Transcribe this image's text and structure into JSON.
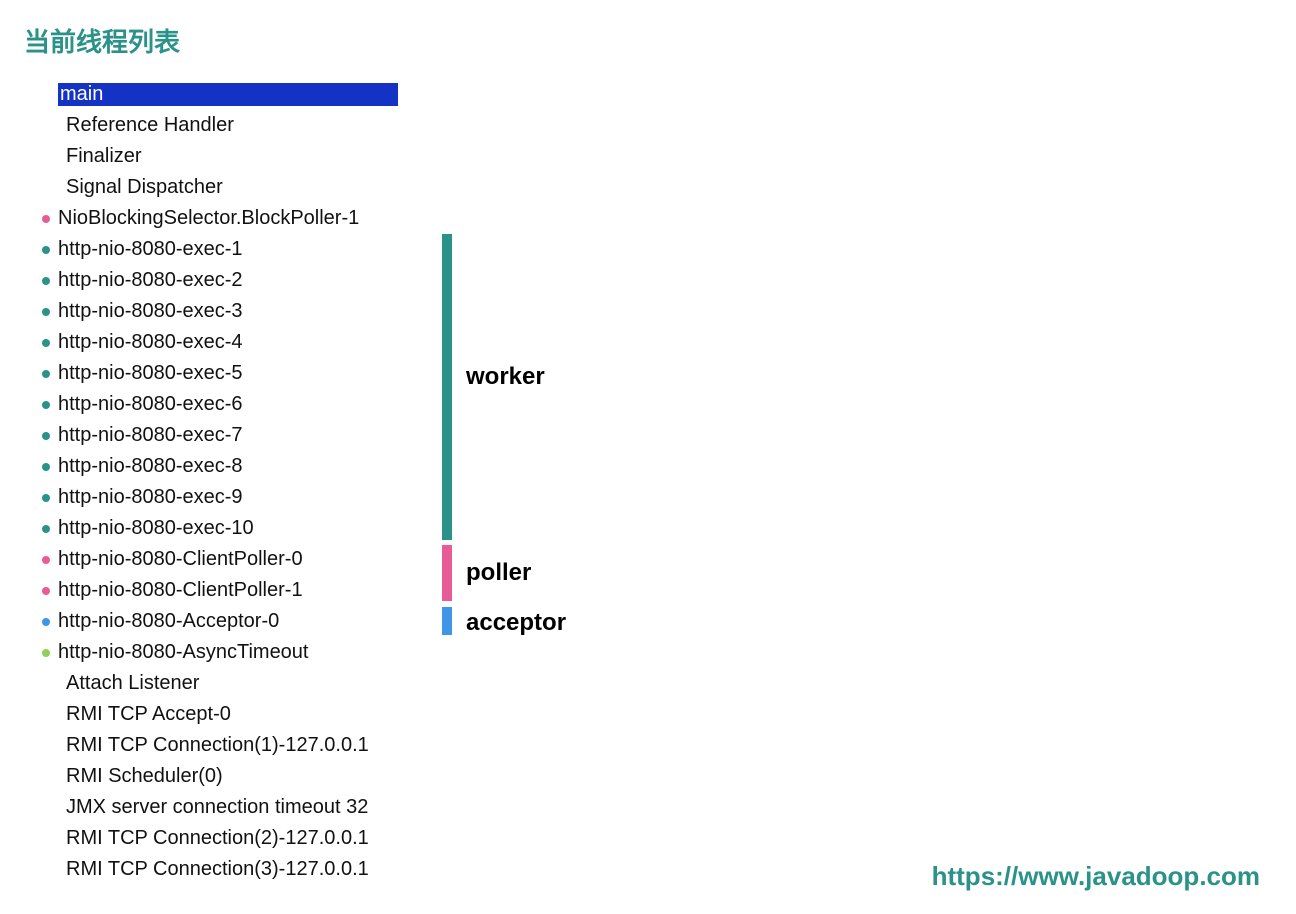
{
  "title": "当前线程列表",
  "watermark": "https://www.javadoop.com",
  "labels": {
    "worker": "worker",
    "poller": "poller",
    "acceptor": "acceptor"
  },
  "colors": {
    "teal": "#2b9289",
    "pink": "#e85b94",
    "blue": "#3f95e6",
    "grass": "#8fd15a",
    "selectBg": "#1432c3"
  },
  "threads": [
    {
      "name": "main",
      "bullet": null,
      "selected": true
    },
    {
      "name": "Reference Handler",
      "bullet": null,
      "selected": false
    },
    {
      "name": "Finalizer",
      "bullet": null,
      "selected": false
    },
    {
      "name": "Signal Dispatcher",
      "bullet": null,
      "selected": false
    },
    {
      "name": "NioBlockingSelector.BlockPoller-1",
      "bullet": "pink",
      "selected": false
    },
    {
      "name": "http-nio-8080-exec-1",
      "bullet": "teal",
      "selected": false
    },
    {
      "name": "http-nio-8080-exec-2",
      "bullet": "teal",
      "selected": false
    },
    {
      "name": "http-nio-8080-exec-3",
      "bullet": "teal",
      "selected": false
    },
    {
      "name": "http-nio-8080-exec-4",
      "bullet": "teal",
      "selected": false
    },
    {
      "name": "http-nio-8080-exec-5",
      "bullet": "teal",
      "selected": false
    },
    {
      "name": "http-nio-8080-exec-6",
      "bullet": "teal",
      "selected": false
    },
    {
      "name": "http-nio-8080-exec-7",
      "bullet": "teal",
      "selected": false
    },
    {
      "name": "http-nio-8080-exec-8",
      "bullet": "teal",
      "selected": false
    },
    {
      "name": "http-nio-8080-exec-9",
      "bullet": "teal",
      "selected": false
    },
    {
      "name": "http-nio-8080-exec-10",
      "bullet": "teal",
      "selected": false
    },
    {
      "name": "http-nio-8080-ClientPoller-0",
      "bullet": "pink",
      "selected": false
    },
    {
      "name": "http-nio-8080-ClientPoller-1",
      "bullet": "pink",
      "selected": false
    },
    {
      "name": "http-nio-8080-Acceptor-0",
      "bullet": "blue",
      "selected": false
    },
    {
      "name": "http-nio-8080-AsyncTimeout",
      "bullet": "grass",
      "selected": false
    },
    {
      "name": "Attach Listener",
      "bullet": null,
      "selected": false
    },
    {
      "name": "RMI TCP Accept-0",
      "bullet": null,
      "selected": false
    },
    {
      "name": "RMI TCP Connection(1)-127.0.0.1",
      "bullet": null,
      "selected": false
    },
    {
      "name": "RMI Scheduler(0)",
      "bullet": null,
      "selected": false
    },
    {
      "name": "JMX server connection timeout 32",
      "bullet": null,
      "selected": false
    },
    {
      "name": "RMI TCP Connection(2)-127.0.0.1",
      "bullet": null,
      "selected": false
    },
    {
      "name": "RMI TCP Connection(3)-127.0.0.1",
      "bullet": null,
      "selected": false
    }
  ]
}
